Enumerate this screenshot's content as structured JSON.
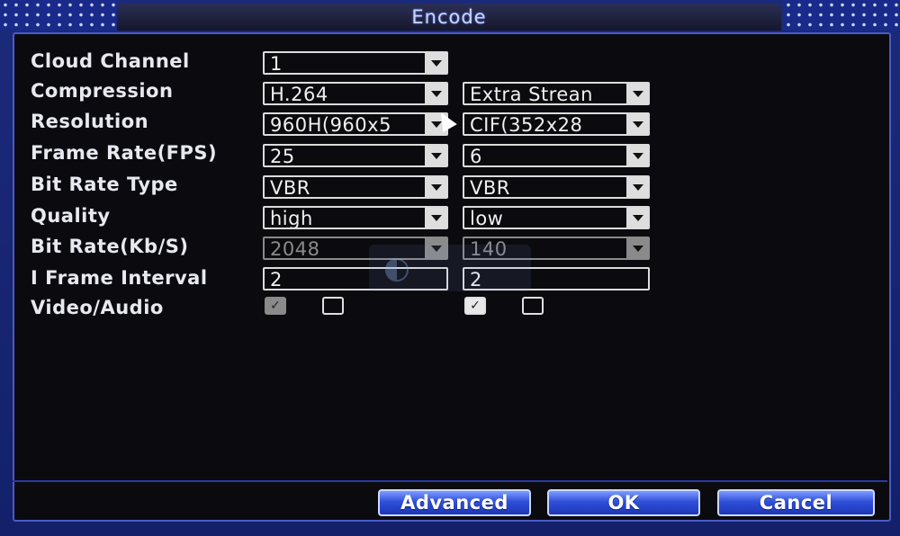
{
  "window": {
    "title": "Encode"
  },
  "rows": [
    {
      "label": "Cloud Channel"
    },
    {
      "label": "Compression"
    },
    {
      "label": "Resolution"
    },
    {
      "label": "Frame Rate(FPS)"
    },
    {
      "label": "Bit Rate Type"
    },
    {
      "label": "Quality"
    },
    {
      "label": "Bit Rate(Kb/S)"
    },
    {
      "label": "I Frame Interval"
    },
    {
      "label": "Video/Audio"
    }
  ],
  "main": {
    "channel": "1",
    "compression": "H.264",
    "resolution": "960H(960x5",
    "frame_rate": "25",
    "bit_rate_type": "VBR",
    "quality": "high",
    "bit_rate": "2048",
    "i_frame_interval": "2",
    "video_checked": true,
    "audio_checked": false
  },
  "extra": {
    "stream": "Extra Strean",
    "resolution": "CIF(352x28",
    "frame_rate": "6",
    "bit_rate_type": "VBR",
    "quality": "low",
    "bit_rate": "140",
    "i_frame_interval": "2",
    "video_checked": true,
    "audio_checked": false
  },
  "buttons": {
    "advanced": "Advanced",
    "ok": "OK",
    "cancel": "Cancel"
  },
  "icons": {
    "dropdown": "chevron-down-icon",
    "checkbox_checked": "checkmark-icon",
    "cursor": "mouse-pointer-icon"
  },
  "colors": {
    "frame": "#1b2a7a",
    "panel": "#0b0b0f",
    "button": "#3050d8",
    "text": "#e8e8f0"
  }
}
